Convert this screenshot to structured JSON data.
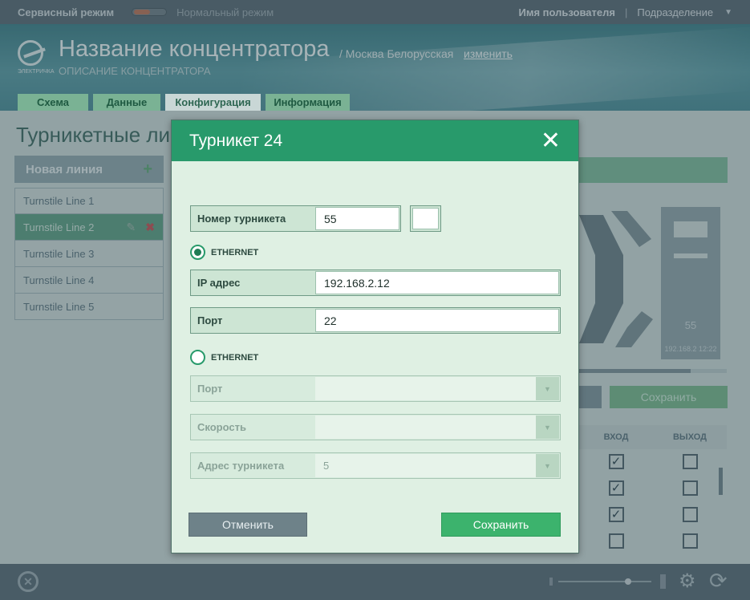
{
  "topbar": {
    "mode_service": "Сервисный режим",
    "mode_normal": "Нормальный режим",
    "user": "Имя пользователя",
    "separator": "|",
    "division": "Подразделение"
  },
  "header": {
    "logo_text": "ЭЛЕКТРИЧКА",
    "title": "Название концентратора",
    "location": "/ Москва Белорусская",
    "change_link": "изменить",
    "description": "ОПИСАНИЕ КОНЦЕНТРАТОРА",
    "tabs": [
      {
        "label": "Схема",
        "active": false
      },
      {
        "label": "Данные",
        "active": false
      },
      {
        "label": "Конфигурация",
        "active": true
      },
      {
        "label": "Информация",
        "active": false
      }
    ]
  },
  "page": {
    "title": "Турникетные линии",
    "new_line_button": "Новая линия",
    "lines": [
      "Turnstile Line 1",
      "Turnstile Line 2",
      "Turnstile Line 3",
      "Turnstile Line 4",
      "Turnstile Line 5"
    ],
    "active_line_index": 1,
    "turnstile_number": "55",
    "turnstile_ip_time": "192.168.2 12:22",
    "progress_fraction": 0.76,
    "save_button": "Сохранить",
    "table_headers": [
      "ВХОД",
      "ВЫХОД"
    ],
    "check_rows": [
      {
        "in": true,
        "out": false
      },
      {
        "in": true,
        "out": false
      },
      {
        "in": true,
        "out": false
      },
      {
        "in": false,
        "out": false
      }
    ]
  },
  "modal": {
    "title": "Турникет 24",
    "turnstile_number_label": "Номер турникета",
    "turnstile_number_value": "55",
    "extra_value": "",
    "ethernet_radio_label": "ETHERNET",
    "ip_label": "IP адрес",
    "ip_value": "192.168.2.12",
    "port_label": "Порт",
    "port_value": "22",
    "second_radio_label": "ETHERNET",
    "serial_port_label": "Порт",
    "serial_port_value": "",
    "speed_label": "Скорость",
    "speed_value": "",
    "address_label": "Адрес турникета",
    "address_value": "5",
    "cancel_button": "Отменить",
    "save_button": "Сохранить"
  },
  "colors": {
    "accent": "#289a6b",
    "save_green": "#3cb36d",
    "cancel_gray": "#6e8289",
    "delete_red": "#c25457"
  }
}
